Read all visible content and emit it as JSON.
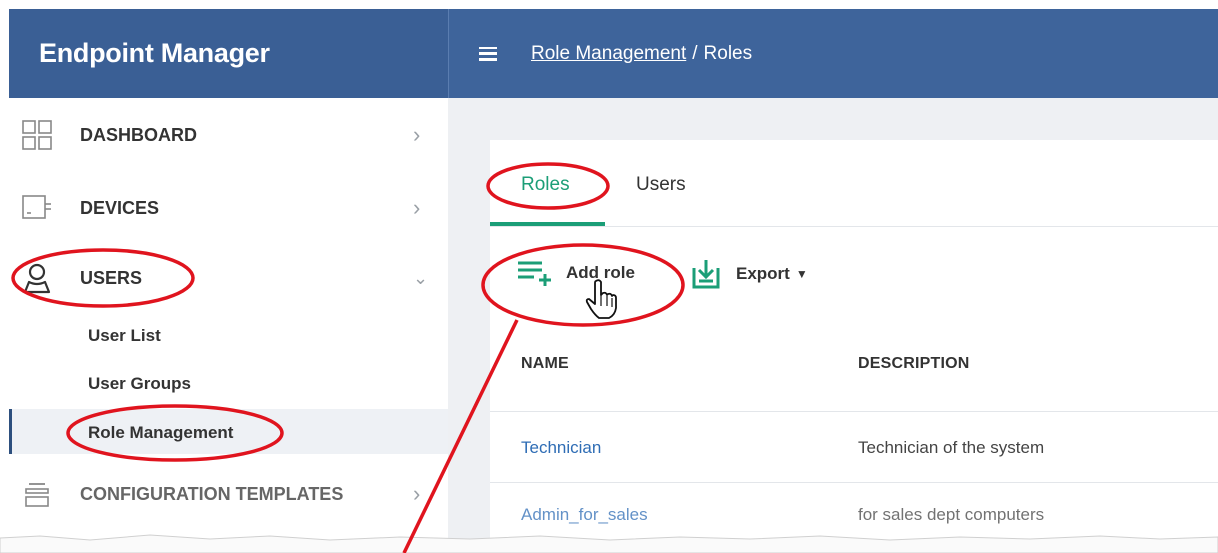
{
  "app": {
    "title": "Endpoint Manager"
  },
  "header": {
    "breadcrumb_link": "Role Management",
    "breadcrumb_sep": "/",
    "breadcrumb_current": "Roles"
  },
  "sidebar": {
    "items": [
      {
        "label": "DASHBOARD",
        "icon": "dashboard-grid-icon",
        "chevron": "›"
      },
      {
        "label": "DEVICES",
        "icon": "devices-icon",
        "chevron": "›"
      },
      {
        "label": "USERS",
        "icon": "user-icon",
        "chevron": "⌄"
      },
      {
        "label": "CONFIGURATION TEMPLATES",
        "icon": "configuration-templates-icon",
        "chevron": "›"
      }
    ],
    "sub_items": [
      "User List",
      "User Groups",
      "Role Management"
    ],
    "active_sub_item": "Role Management"
  },
  "tabs": [
    {
      "label": "Roles",
      "active": true
    },
    {
      "label": "Users",
      "active": false
    }
  ],
  "toolbar": {
    "add_role_label": "Add role",
    "export_label": "Export"
  },
  "table": {
    "columns": [
      "NAME",
      "DESCRIPTION"
    ],
    "rows": [
      {
        "name": "Technician",
        "description": "Technician of the system"
      },
      {
        "name": "Admin_for_sales",
        "description": "for sales dept computers"
      }
    ]
  },
  "colors": {
    "brand_bar": "#3a5f95",
    "header_bar": "#3e649b",
    "accent_green": "#1b9e77",
    "link_blue": "#2f6db5",
    "annotation_red": "#e0141e"
  }
}
